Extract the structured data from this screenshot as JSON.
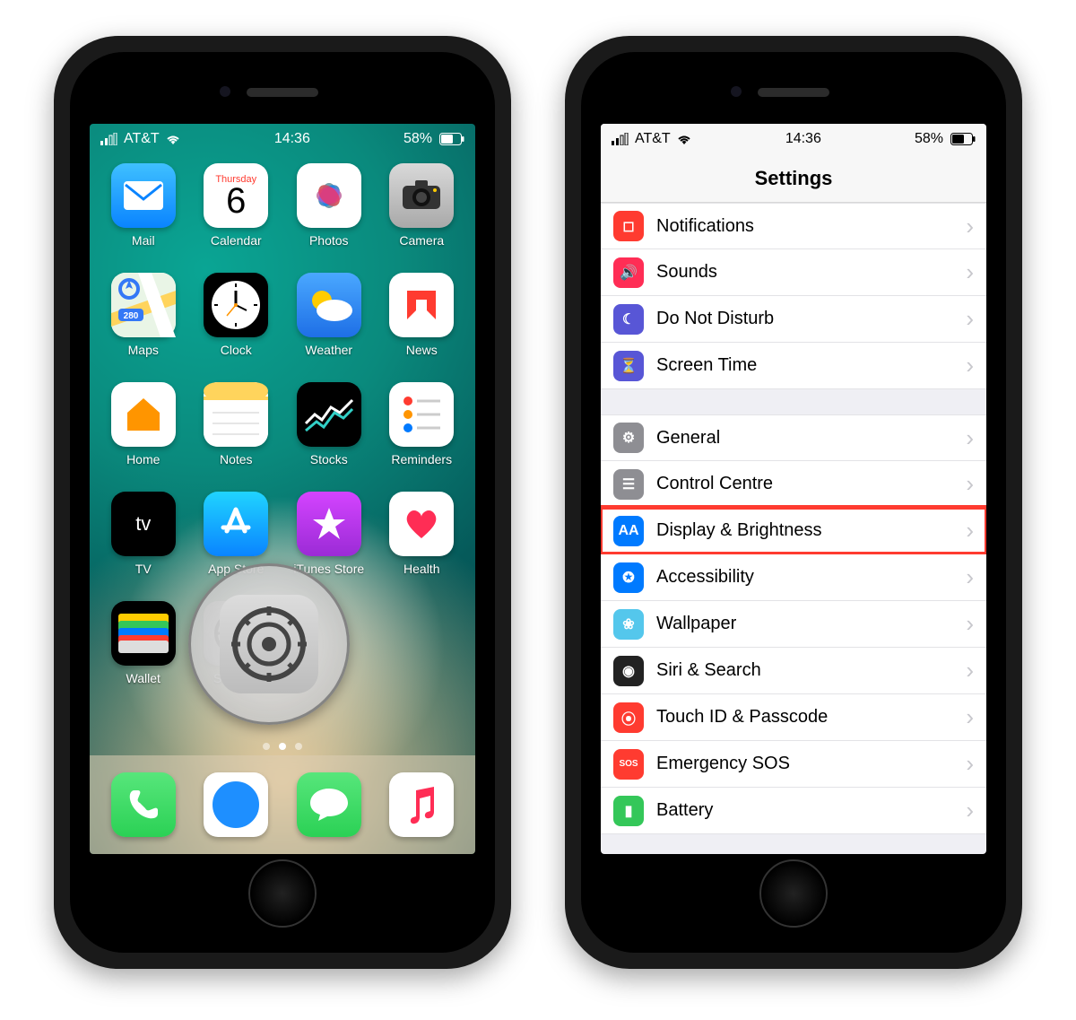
{
  "status": {
    "carrier": "AT&T",
    "time": "14:36",
    "battery_pct": "58%"
  },
  "home": {
    "calendar_day_name": "Thursday",
    "calendar_day_num": "6",
    "apps": [
      {
        "label": "Mail"
      },
      {
        "label": "Calendar"
      },
      {
        "label": "Photos"
      },
      {
        "label": "Camera"
      },
      {
        "label": "Maps"
      },
      {
        "label": "Clock"
      },
      {
        "label": "Weather"
      },
      {
        "label": "News"
      },
      {
        "label": "Home"
      },
      {
        "label": "Notes"
      },
      {
        "label": "Stocks"
      },
      {
        "label": "Reminders"
      },
      {
        "label": "TV"
      },
      {
        "label": "App Store"
      },
      {
        "label": "iTunes Store"
      },
      {
        "label": "Health"
      },
      {
        "label": "Wallet"
      },
      {
        "label": "Settings"
      }
    ],
    "dock": [
      {
        "label": "Phone"
      },
      {
        "label": "Safari"
      },
      {
        "label": "Messages"
      },
      {
        "label": "Music"
      }
    ],
    "magnified_app": "Settings"
  },
  "settings": {
    "title": "Settings",
    "highlighted_row": "Display & Brightness",
    "rows_group1": [
      {
        "label": "Notifications",
        "icon_bg": "#ff3b30",
        "icon_txt": "◻"
      },
      {
        "label": "Sounds",
        "icon_bg": "#ff2d55",
        "icon_txt": "🔊"
      },
      {
        "label": "Do Not Disturb",
        "icon_bg": "#5856d6",
        "icon_txt": "☾"
      },
      {
        "label": "Screen Time",
        "icon_bg": "#5856d6",
        "icon_txt": "⏳"
      }
    ],
    "rows_group2": [
      {
        "label": "General",
        "icon_bg": "#8e8e93",
        "icon_txt": "⚙"
      },
      {
        "label": "Control Centre",
        "icon_bg": "#8e8e93",
        "icon_txt": "☰"
      },
      {
        "label": "Display & Brightness",
        "icon_bg": "#007aff",
        "icon_txt": "AA"
      },
      {
        "label": "Accessibility",
        "icon_bg": "#007aff",
        "icon_txt": "✪"
      },
      {
        "label": "Wallpaper",
        "icon_bg": "#54c7ec",
        "icon_txt": "❀"
      },
      {
        "label": "Siri & Search",
        "icon_bg": "#222",
        "icon_txt": "◉"
      },
      {
        "label": "Touch ID & Passcode",
        "icon_bg": "#ff3b30",
        "icon_txt": "⦿"
      },
      {
        "label": "Emergency SOS",
        "icon_bg": "#ff3b30",
        "icon_txt": "SOS"
      },
      {
        "label": "Battery",
        "icon_bg": "#34c759",
        "icon_txt": "▮"
      }
    ]
  }
}
